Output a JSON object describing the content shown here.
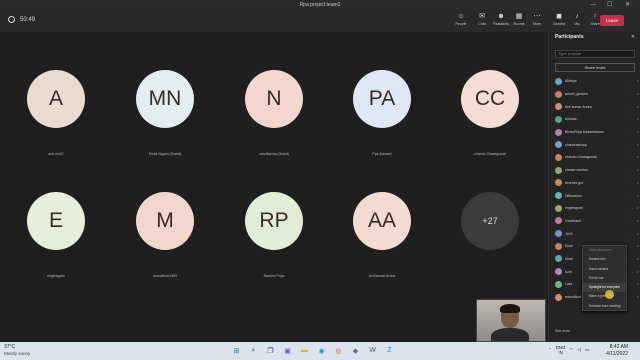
{
  "window": {
    "title": "Rpa project team1",
    "min": "—",
    "max": "☐",
    "close": "✕"
  },
  "meeting": {
    "timer": "50:49",
    "toolbar": [
      {
        "label": "People",
        "icon": "☺"
      },
      {
        "label": "Chat",
        "icon": "✉"
      },
      {
        "label": "Reactions",
        "icon": "☻"
      },
      {
        "label": "Rooms",
        "icon": "▦"
      },
      {
        "label": "More",
        "icon": "⋯"
      },
      {
        "label": "Camera",
        "icon": "◼"
      },
      {
        "label": "Mic",
        "icon": "♪"
      },
      {
        "label": "Share",
        "icon": "↑"
      }
    ],
    "leave_label": "Leave"
  },
  "tiles": [
    {
      "initials": "A",
      "name": "anil.mo07",
      "color": "#eadbd3"
    },
    {
      "initials": "MN",
      "name": "Mohit Nigam (Guest)",
      "color": "#e3eef0"
    },
    {
      "initials": "N",
      "name": "nanditarma (Guest)",
      "color": "#f4d6d0"
    },
    {
      "initials": "PA",
      "name": "Pps Avinash",
      "color": "#dfe8f7"
    },
    {
      "initials": "CC",
      "name": "chandu Charagonda",
      "color": "#f5dcd5"
    },
    {
      "initials": "E",
      "name": "englesgsmi",
      "color": "#e7eddc"
    },
    {
      "initials": "M",
      "name": "manuthi.m1989",
      "color": "#f4d7cc"
    },
    {
      "initials": "RP",
      "name": "Rashmi Priya",
      "color": "#e3ecd6"
    },
    {
      "initials": "AA",
      "name": "Anil kumar Andra",
      "color": "#f4dcd3"
    }
  ],
  "more_count": "+27",
  "participants": {
    "title": "Participants",
    "close": "✕",
    "search_placeholder": "Type a name",
    "share_invite": "Share invite",
    "list": [
      {
        "name": "Akhhya",
        "color": "#6fa0c6"
      },
      {
        "name": "amani_gontela",
        "color": "#c77a6a"
      },
      {
        "name": "Anil kumar Andra",
        "color": "#d48a75"
      },
      {
        "name": "Avinash",
        "color": "#5f9a8b"
      },
      {
        "name": "BinduPriya Kadambaram",
        "color": "#b07fb2"
      },
      {
        "name": "chandrashsup",
        "color": "#7a9bc9"
      },
      {
        "name": "chandu Charagonda",
        "color": "#d27c6d"
      },
      {
        "name": "chetan dumbre",
        "color": "#8ea86a"
      },
      {
        "name": "dershini.gsl",
        "color": "#c28f5b"
      },
      {
        "name": "Dilbuanam",
        "color": "#6ab0b4"
      },
      {
        "name": "englesgsmi",
        "color": "#93a96d"
      },
      {
        "name": "Gowthami",
        "color": "#b87c9d"
      },
      {
        "name": "Jai K",
        "color": "#7c8fc4"
      },
      {
        "name": "Kiran",
        "color": "#c9826a"
      },
      {
        "name": "Kiran",
        "color": "#6d9fb0"
      },
      {
        "name": "kum",
        "color": "#a98bc0"
      },
      {
        "name": "Laks",
        "color": "#7fae8a"
      },
      {
        "name": "manuthi.m1989",
        "color": "#d08c74"
      }
    ],
    "see_more": "See more"
  },
  "context_menu": [
    {
      "label": "Mute participant",
      "state": "disabled"
    },
    {
      "label": "Disable mic",
      "state": "normal"
    },
    {
      "label": "Allow camera",
      "state": "normal"
    },
    {
      "label": "Pin for me",
      "state": "normal"
    },
    {
      "label": "Spotlight for everyone",
      "state": "highlight"
    },
    {
      "label": "Make a presenter",
      "state": "normal"
    },
    {
      "label": "Remove from meeting",
      "state": "normal"
    }
  ],
  "taskbar": {
    "weather_temp": "37°C",
    "weather_desc": "Mostly sunny",
    "lang": "ENG",
    "lang_region": "IN",
    "time": "8:42 AM",
    "date": "4/11/2022",
    "icons": [
      {
        "name": "start",
        "glyph": "⊞",
        "color": "#1a6fd6"
      },
      {
        "name": "search",
        "glyph": "⌕",
        "color": "#333"
      },
      {
        "name": "task-view",
        "glyph": "❐",
        "color": "#333"
      },
      {
        "name": "teams",
        "glyph": "▣",
        "color": "#5b5fc7"
      },
      {
        "name": "file-explorer",
        "glyph": "▬",
        "color": "#e8b330"
      },
      {
        "name": "edge",
        "glyph": "◉",
        "color": "#1f9bd1"
      },
      {
        "name": "chrome",
        "glyph": "◎",
        "color": "#d94a38"
      },
      {
        "name": "store",
        "glyph": "◆",
        "color": "#5b5fc7"
      },
      {
        "name": "word",
        "glyph": "W",
        "color": "#2b5cb3"
      },
      {
        "name": "zoom",
        "glyph": "Z",
        "color": "#2d8cff"
      }
    ]
  }
}
